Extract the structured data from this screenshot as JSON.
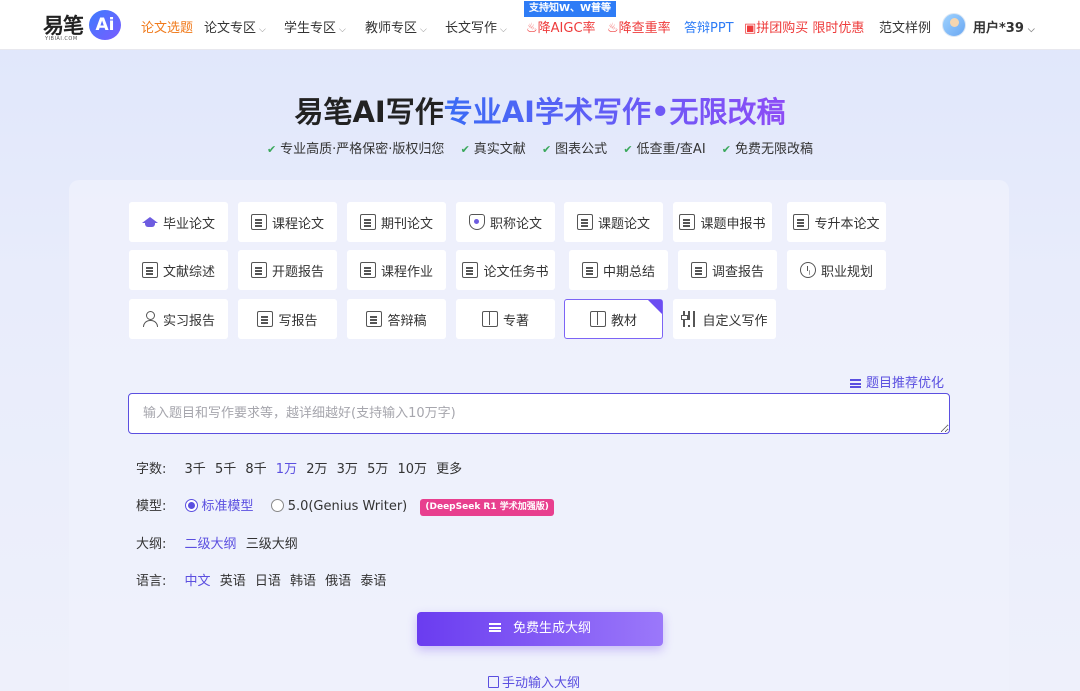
{
  "header": {
    "logo_text": "易笔",
    "logo_ai": "Ai",
    "logo_sub": "YIBIAI.COM",
    "nav": [
      {
        "label": "论文选题",
        "style": "orange",
        "chev": false
      },
      {
        "label": "论文专区",
        "style": "",
        "chev": true
      },
      {
        "label": "学生专区",
        "style": "",
        "chev": true
      },
      {
        "label": "教师专区",
        "style": "",
        "chev": true
      },
      {
        "label": "长文写作",
        "style": "",
        "chev": true
      },
      {
        "label": "降AIGC率",
        "style": "red",
        "chev": false
      },
      {
        "label": "降查重率",
        "style": "red",
        "chev": false
      },
      {
        "label": "答辩PPT",
        "style": "blue",
        "chev": false
      },
      {
        "label": "拼团购买 限时优惠",
        "style": "red",
        "chev": false
      },
      {
        "label": "范文样例",
        "style": "",
        "chev": false
      }
    ],
    "support_badge": "支持知W、W普等",
    "user_name": "用户*39"
  },
  "hero": {
    "title_a": "易笔AI写作",
    "title_b": "专业AI学术写作•无限改稿",
    "features": [
      "专业高质·严格保密·版权归您",
      "真实文献",
      "图表公式",
      "低查重/查AI",
      "免费无限改稿"
    ]
  },
  "types": [
    {
      "label": "毕业论文",
      "icon": "graduation-cap-icon"
    },
    {
      "label": "课程论文",
      "icon": "document-icon"
    },
    {
      "label": "期刊论文",
      "icon": "journal-icon"
    },
    {
      "label": "职称论文",
      "icon": "shield-icon"
    },
    {
      "label": "课题论文",
      "icon": "notebook-icon"
    },
    {
      "label": "课题申报书",
      "icon": "document-icon"
    },
    {
      "label": "专升本论文",
      "icon": "edit-document-icon"
    },
    {
      "label": "文献综述",
      "icon": "document-icon"
    },
    {
      "label": "开题报告",
      "icon": "report-icon"
    },
    {
      "label": "课程作业",
      "icon": "edit-document-icon"
    },
    {
      "label": "论文任务书",
      "icon": "document-icon"
    },
    {
      "label": "中期总结",
      "icon": "document-icon"
    },
    {
      "label": "调查报告",
      "icon": "report-icon"
    },
    {
      "label": "职业规划",
      "icon": "clock-icon"
    },
    {
      "label": "实习报告",
      "icon": "person-icon"
    },
    {
      "label": "写报告",
      "icon": "search-document-icon"
    },
    {
      "label": "答辩稿",
      "icon": "checklist-icon"
    },
    {
      "label": "专著",
      "icon": "book-icon"
    },
    {
      "label": "教材",
      "icon": "book-icon",
      "active": true
    },
    {
      "label": "自定义写作",
      "icon": "sliders-icon"
    }
  ],
  "optimize_label": "题目推荐优化",
  "input": {
    "placeholder": "输入题目和写作要求等，越详细越好(支持输入10万字)"
  },
  "wordcount": {
    "label": "字数:",
    "options": [
      "3千",
      "5千",
      "8千",
      "1万",
      "2万",
      "3万",
      "5万",
      "10万",
      "更多"
    ],
    "selected": "1万"
  },
  "model": {
    "label": "模型:",
    "options": [
      "标准模型",
      "5.0(Genius Writer)"
    ],
    "selected": "标准模型",
    "badge": "(DeepSeek R1 学术加强版)"
  },
  "outline": {
    "label": "大纲:",
    "options": [
      "二级大纲",
      "三级大纲"
    ],
    "selected": "二级大纲"
  },
  "language": {
    "label": "语言:",
    "options": [
      "中文",
      "英语",
      "日语",
      "韩语",
      "俄语",
      "泰语"
    ],
    "selected": "中文"
  },
  "generate_button": "免费生成大纲",
  "manual_link": "手动输入大纲",
  "colors": {
    "accent": "#5b4fe0",
    "nav_orange": "#f07a1b",
    "nav_red": "#ee3b3b",
    "nav_blue": "#2e7cf6"
  }
}
